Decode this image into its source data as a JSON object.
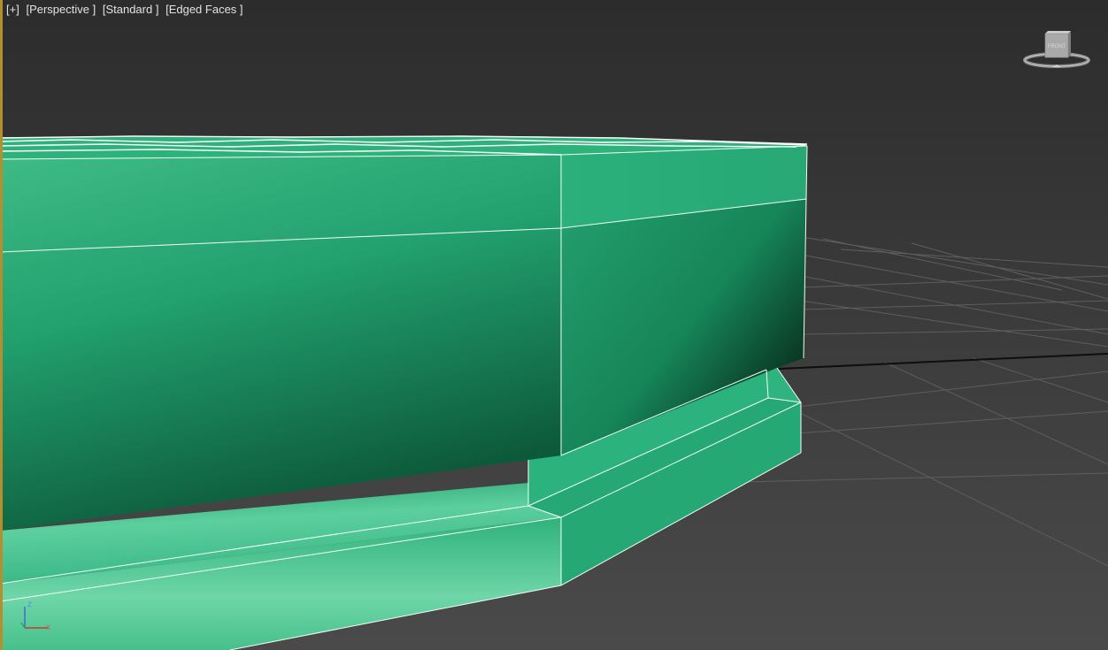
{
  "viewport": {
    "labels": {
      "plus": "[+]",
      "view": "[Perspective ]",
      "shading": "[Standard ]",
      "display": "[Edged Faces ]"
    },
    "viewcube": {
      "face_label": "FRONT"
    },
    "axis": {
      "x_label": "x",
      "z_label": "z"
    },
    "colors": {
      "object": "#27ad78",
      "edge": "#f2fff8",
      "grid": "#5e5e5e",
      "active_border": "#b38f2e"
    }
  }
}
